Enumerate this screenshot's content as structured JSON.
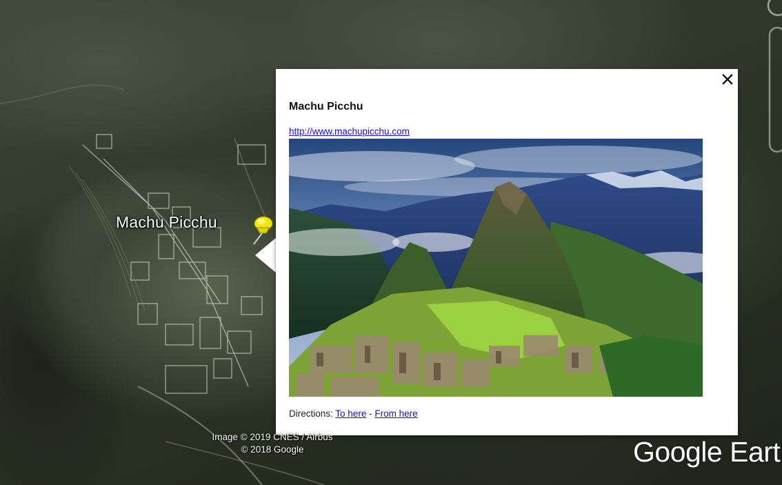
{
  "map": {
    "place_label": "Machu Picchu",
    "attribution_line1": "Image © 2019 CNES / Airbus",
    "attribution_line2": "© 2018 Google",
    "logo_text": "Google Earth"
  },
  "balloon": {
    "title": "Machu Picchu",
    "link_text": "http://www.machupicchu.com",
    "directions_label": "Directions:",
    "to_here": "To here",
    "separator": "-",
    "from_here": "From here",
    "close_icon": "close-icon"
  },
  "colors": {
    "link": "#1a0dcc",
    "pushpin": "#f2e600",
    "balloon_bg": "#ffffff"
  }
}
